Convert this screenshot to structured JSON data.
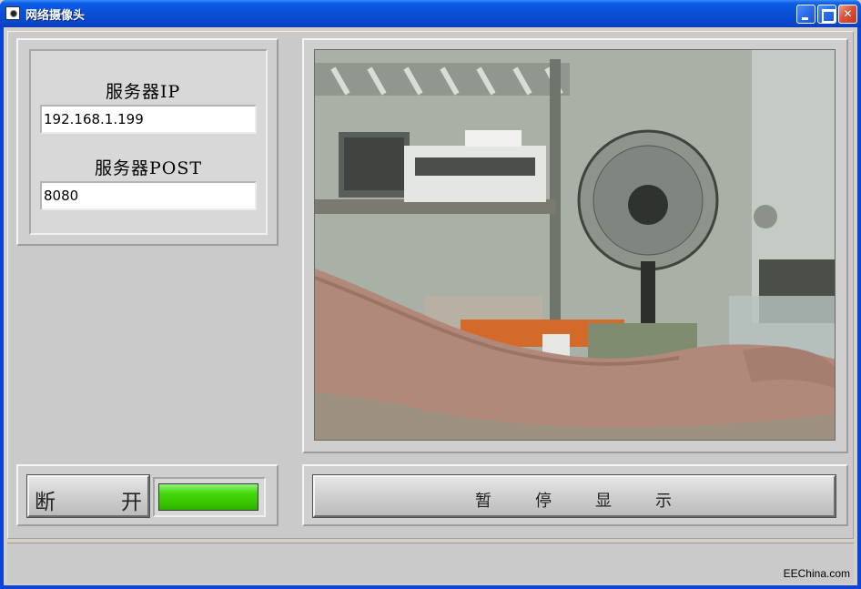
{
  "window": {
    "title": "网络摄像头"
  },
  "server": {
    "ip_label": "服务器IP",
    "ip_value": "192.168.1.199",
    "port_label": "服务器POST",
    "port_value": "8080"
  },
  "controls": {
    "disconnect_left": "断",
    "disconnect_right": "开",
    "pause_chars": [
      "暂",
      "停",
      "显",
      "示"
    ]
  },
  "status": {
    "connected_indicator_color": "#44d80c"
  },
  "watermark": "EEChina.com",
  "icons": [
    "app-camera-icon",
    "minimize-icon",
    "maximize-icon",
    "close-icon"
  ]
}
